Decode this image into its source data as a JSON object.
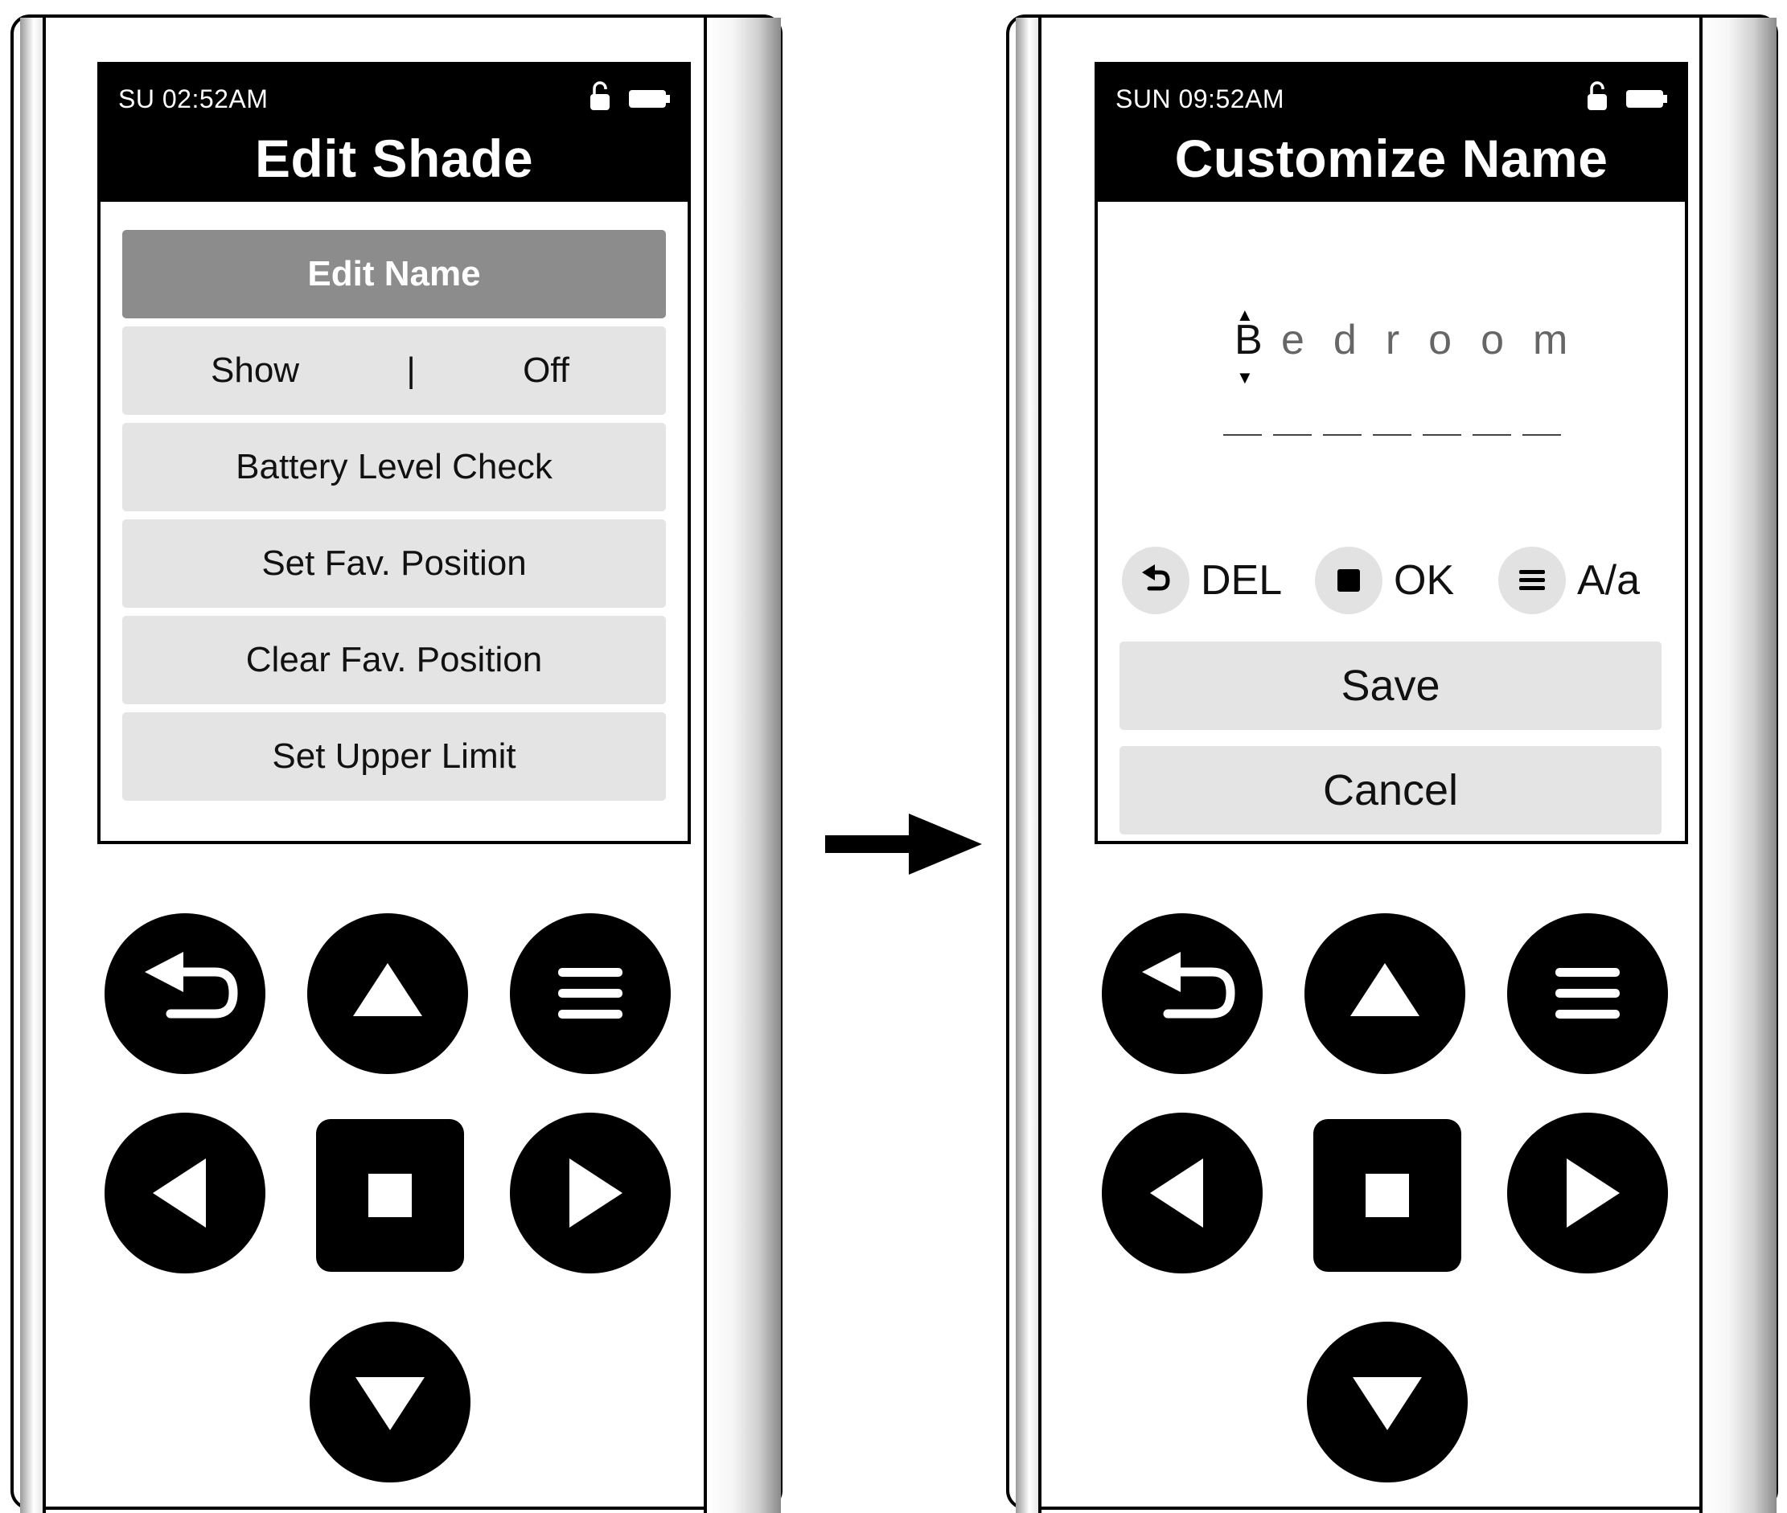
{
  "screens": [
    {
      "id": "edit-shade",
      "status_time": "SU 02:52AM",
      "title": "Edit Shade",
      "menu": [
        {
          "label": "Edit Name",
          "selected": true
        },
        {
          "label": "Show",
          "separator": "|",
          "value": "Off"
        },
        {
          "label": "Battery Level Check"
        },
        {
          "label": "Set Fav. Position"
        },
        {
          "label": "Clear Fav. Position"
        },
        {
          "label": "Set Upper Limit"
        }
      ]
    },
    {
      "id": "customize-name",
      "status_time": "SUN 09:52AM",
      "title": "Customize Name",
      "name_entry": {
        "current_char": "B",
        "rest": "edroom"
      },
      "controls": [
        {
          "icon": "back-arrow-icon",
          "label": "DEL"
        },
        {
          "icon": "stop-square-icon",
          "label": "OK"
        },
        {
          "icon": "menu-lines-icon",
          "label": "A/a"
        }
      ],
      "buttons": {
        "save": "Save",
        "cancel": "Cancel"
      }
    }
  ],
  "keypad_icons": [
    "back-arrow-icon",
    "up-arrow-icon",
    "menu-icon",
    "left-arrow-icon",
    "stop-icon",
    "right-arrow-icon",
    "down-arrow-icon"
  ],
  "colors": {
    "screen_header": "#000000",
    "menu_item": "#e4e4e4",
    "menu_item_selected": "#8c8c8c",
    "key": "#000000"
  }
}
